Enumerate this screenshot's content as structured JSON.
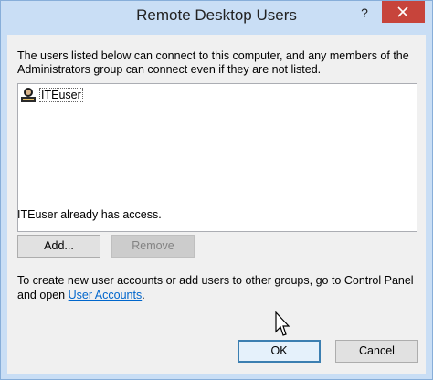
{
  "window": {
    "title": "Remote Desktop Users",
    "help_label": "?"
  },
  "dialog": {
    "description": "The users listed below can connect to this computer, and any members of the Administrators group can connect even if they are not listed.",
    "users": [
      {
        "name": "ITEuser",
        "icon": "user-icon"
      }
    ],
    "access_status": "ITEuser already has access.",
    "add_label": "Add...",
    "remove_label": "Remove",
    "info_text": "To create new user accounts or add users to other groups, go to Control Panel and open",
    "info_link": "User Accounts",
    "info_suffix": ".",
    "ok_label": "OK",
    "cancel_label": "Cancel"
  },
  "colors": {
    "frame": "#c9def5",
    "close": "#c7443b",
    "link": "#0066cc",
    "default_button_border": "#3c7fb1"
  }
}
